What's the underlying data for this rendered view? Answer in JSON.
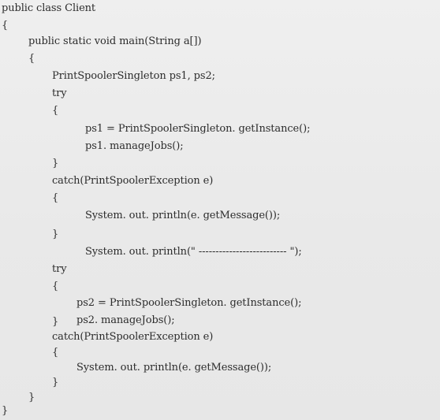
{
  "code": {
    "lines": [
      "public class Client",
      "{",
      "public static void main(String a[])",
      "{",
      "PrintSpoolerSingleton ps1, ps2;",
      "try",
      "{",
      "ps1 = PrintSpoolerSingleton. getInstance();",
      "ps1. manageJobs();",
      "}",
      "catch(PrintSpoolerException e)",
      "{",
      "System. out. println(e. getMessage());",
      "}",
      "System. out. println(\" -------------------------- \");",
      "try",
      "{",
      "ps2 = PrintSpoolerSingleton. getInstance();",
      "ps2. manageJobs();",
      "}",
      "catch(PrintSpoolerException e)",
      "{",
      "System. out. println(e. getMessage());",
      "}",
      "}",
      "}"
    ]
  }
}
